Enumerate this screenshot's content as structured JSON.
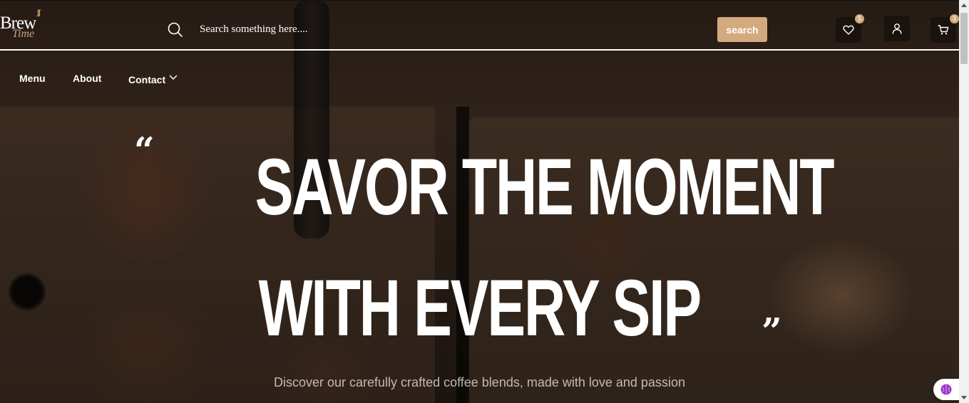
{
  "header": {
    "logo": {
      "main": "Brew",
      "sub": "Time"
    },
    "search": {
      "placeholder": "Search something here....",
      "button_label": "search"
    },
    "wishlist": {
      "count": "5",
      "icon": "heart-icon"
    },
    "account": {
      "icon": "user-icon"
    },
    "cart": {
      "count": "3",
      "icon": "cart-icon"
    }
  },
  "nav": {
    "items": [
      {
        "label": "Menu"
      },
      {
        "label": "About"
      },
      {
        "label": "Contact"
      }
    ]
  },
  "hero": {
    "quote_open": "“",
    "title_line1": "SAVOR THE MOMENT",
    "title_line2": "WITH EVERY SIP",
    "quote_close": "”",
    "subtitle": "Discover our carefully crafted coffee blends, made with love and passion"
  },
  "colors": {
    "accent": "#d2aa7e",
    "text": "#ffffff"
  }
}
